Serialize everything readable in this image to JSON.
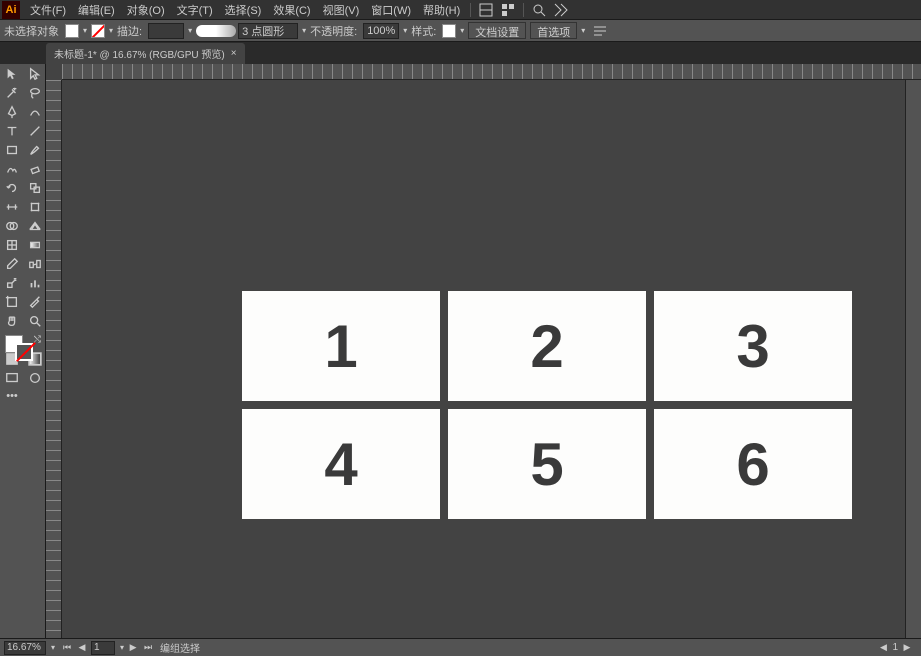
{
  "app": {
    "id": "Ai"
  },
  "menu": {
    "file": "文件(F)",
    "edit": "编辑(E)",
    "object": "对象(O)",
    "type": "文字(T)",
    "select": "选择(S)",
    "effect": "效果(C)",
    "view": "视图(V)",
    "window": "窗口(W)",
    "help": "帮助(H)"
  },
  "controlbar": {
    "noselection": "未选择对象",
    "stroke_label": "描边:",
    "stroke_style": "3 点圆形",
    "opacity_label": "不透明度:",
    "opacity_value": "100%",
    "style_label": "样式:",
    "docsetup": "文档设置",
    "prefs": "首选项"
  },
  "doctab": {
    "title": "未标题-1* @ 16.67% (RGB/GPU 预览)"
  },
  "artwork": {
    "cells": [
      "1",
      "2",
      "3",
      "4",
      "5",
      "6"
    ]
  },
  "status": {
    "zoom": "16.67%",
    "nav_value": "1",
    "tool": "编组选择",
    "step": "1"
  }
}
